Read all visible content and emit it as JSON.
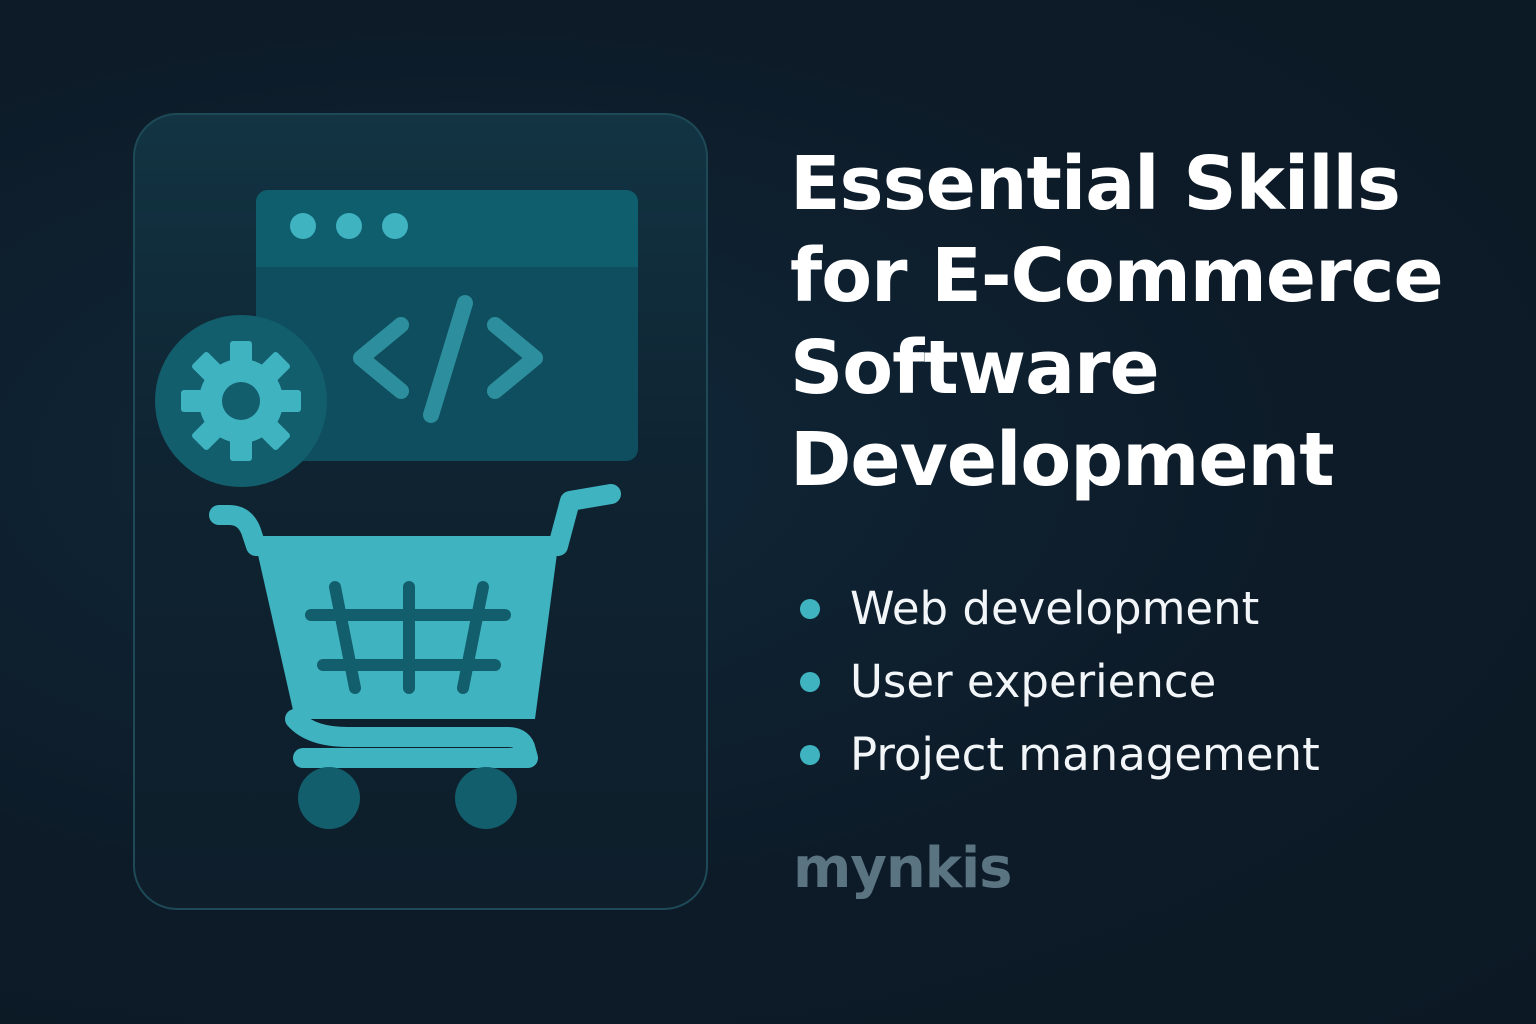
{
  "title_lines": [
    "Essential Skills",
    "for E-Commerce",
    "Software",
    "Development"
  ],
  "skills": [
    "Web development",
    "User experience",
    "Project management"
  ],
  "brand": "mynkis",
  "colors": {
    "background": "#0d1b28",
    "accent": "#3fb3c0",
    "title": "#ffffff",
    "brand": "#5b7481"
  },
  "icons": [
    "browser-window-icon",
    "code-icon",
    "gear-icon",
    "shopping-cart-icon"
  ]
}
